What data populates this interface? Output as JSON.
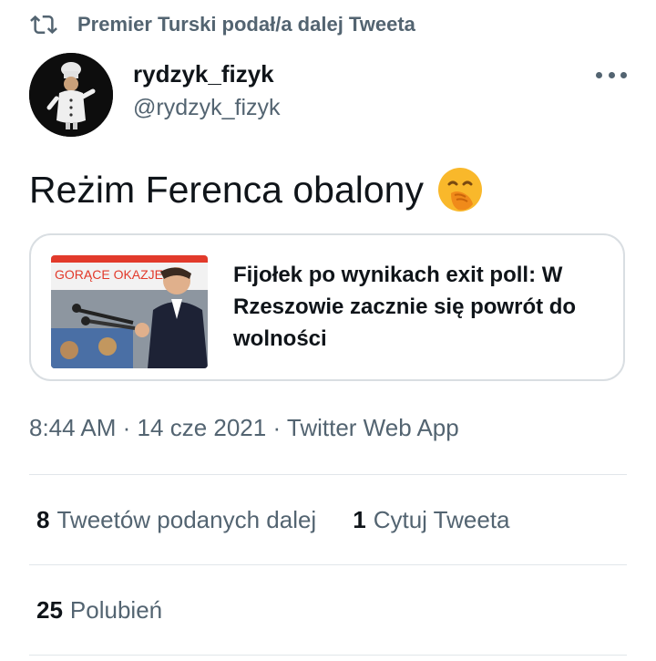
{
  "retweet": {
    "icon": "retweet-icon",
    "text": "Premier Turski podał/a dalej Tweeta"
  },
  "author": {
    "name": "rydzyk_fizyk",
    "handle": "@rydzyk_fizyk",
    "avatar_icon": "chef-figure-avatar"
  },
  "tweet": {
    "text": "Reżim Ferenca obalony",
    "emoji_icon": "face-with-hand-over-mouth-emoji"
  },
  "card": {
    "title": "Fijołek po wynikach exit poll: W Rzeszowie zacznie się powrót do wolności",
    "image_banner_text": "GORĄCE OKAZJE"
  },
  "meta": {
    "time": "8:44 AM",
    "date": "14 cze 2021",
    "source": "Twitter Web App",
    "separator": "·"
  },
  "stats": {
    "retweets_count": "8",
    "retweets_label": "Tweetów podanych dalej",
    "quotes_count": "1",
    "quotes_label": "Cytuj Tweeta",
    "likes_count": "25",
    "likes_label": "Polubień"
  },
  "colors": {
    "text_primary": "#0f1419",
    "text_secondary": "#536471",
    "border": "#d9dee2"
  }
}
